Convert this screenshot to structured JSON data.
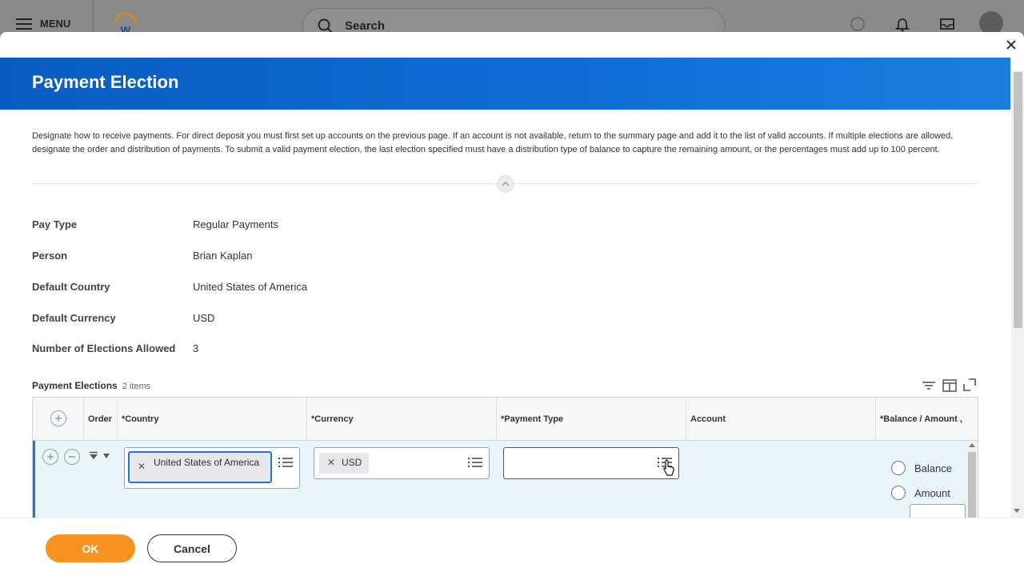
{
  "appbar": {
    "menu_label": "MENU",
    "search_placeholder": "Search"
  },
  "modal": {
    "title": "Payment Election",
    "description": "Designate how to receive payments. For direct deposit you must first set up accounts on the previous page. If an account is not available, return to the summary page and add it to the list of valid accounts. If multiple elections are allowed, designate the order and distribution of payments. To submit a valid payment election, the last election specified must have a distribution type of balance to capture the remaining amount, or the percentages must add up to 100 percent."
  },
  "fields": [
    {
      "label": "Pay Type",
      "value": "Regular Payments"
    },
    {
      "label": "Person",
      "value": "Brian Kaplan"
    },
    {
      "label": "Default Country",
      "value": "United States of America"
    },
    {
      "label": "Default Currency",
      "value": "USD"
    },
    {
      "label": "Number of Elections Allowed",
      "value": "3"
    }
  ],
  "elections": {
    "title": "Payment Elections",
    "count": "2 items",
    "columns": {
      "order": "Order",
      "country": "*Country",
      "currency": "*Currency",
      "payment_type": "*Payment Type",
      "account": "Account",
      "balance_amount": "*Balance / Amount ,"
    },
    "row1": {
      "country": "United States of America",
      "currency": "USD",
      "payment_type": "",
      "account": "",
      "radio_balance": "Balance",
      "radio_amount": "Amount"
    }
  },
  "footer": {
    "ok_label": "OK",
    "cancel_label": "Cancel"
  },
  "colors": {
    "header_blue": "#0a5cc2",
    "ok_orange": "#f7931e",
    "row_highlight": "#e9f4fb"
  }
}
